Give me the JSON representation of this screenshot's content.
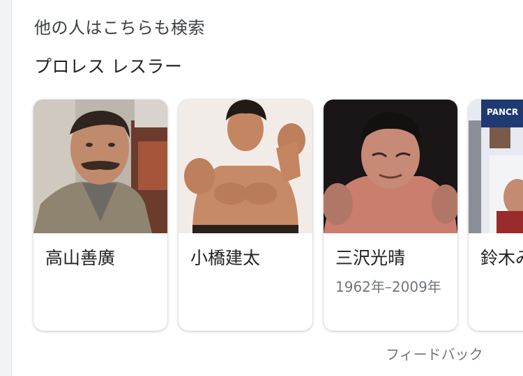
{
  "section": {
    "heading": "他の人はこちらも検索",
    "subheading": "プロレス レスラー"
  },
  "cards": [
    {
      "name": "高山善廣",
      "years": "",
      "image_icon": "person-photo-mustache-man"
    },
    {
      "name": "小橋建太",
      "years": "",
      "image_icon": "person-photo-wrestler-pose"
    },
    {
      "name": "三沢光晴",
      "years": "1962年–2009年",
      "image_icon": "person-photo-wrestler-sweat"
    },
    {
      "name": "鈴木み",
      "years": "",
      "image_icon": "person-photo-pancrase-poster",
      "photo_text": "PANCR"
    }
  ],
  "footer": {
    "feedback_label": "フィードバック"
  }
}
